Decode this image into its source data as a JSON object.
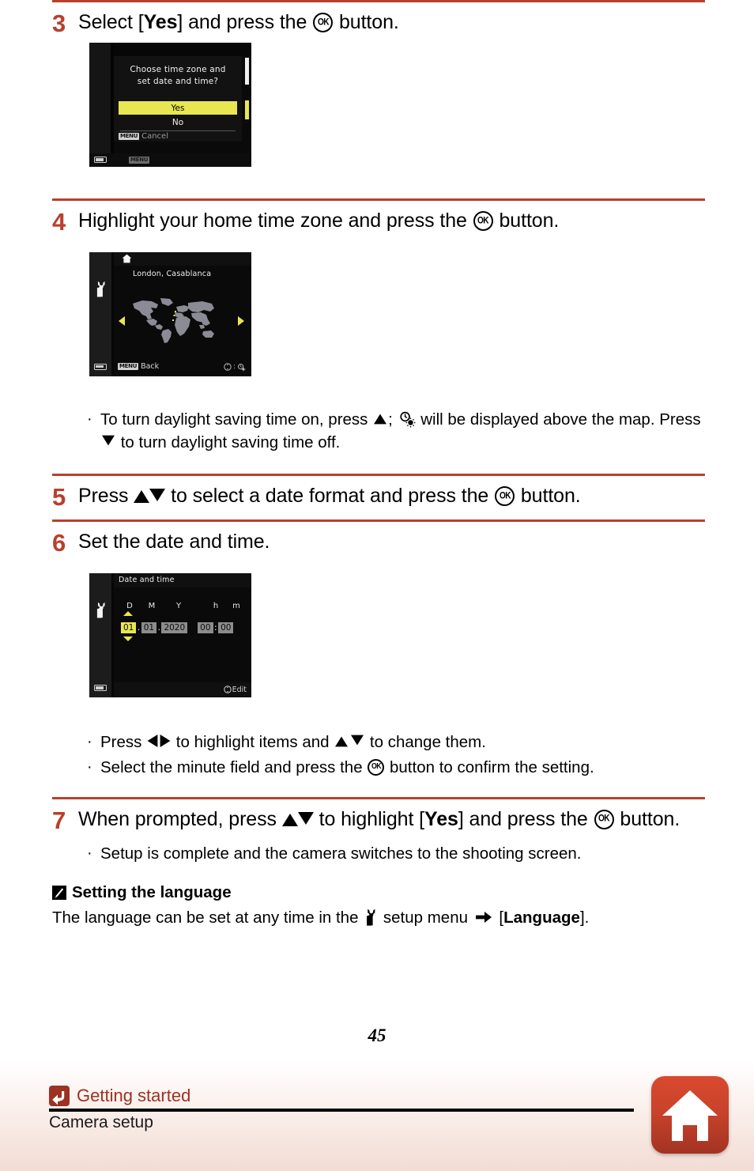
{
  "page": {
    "number": "45",
    "accent_red": "#b8402c",
    "footer_red": "#9d3122"
  },
  "steps": [
    {
      "number": "3",
      "text_before": "Select [",
      "bold": "Yes",
      "text_mid": "] and press the ",
      "text_after": " button."
    },
    {
      "number": "4",
      "text_before": "Highlight your home time zone and press the ",
      "text_after": " button."
    },
    {
      "number": "5",
      "text_before": "Press ",
      "text_mid": " to select a date format and press the ",
      "text_after": " button."
    },
    {
      "number": "6",
      "text_before": "Set the date and time."
    },
    {
      "number": "7",
      "text_before": "When prompted, press ",
      "text_mid": " to highlight [",
      "bold": "Yes",
      "text_mid2": "] and press the ",
      "text_after": " button."
    }
  ],
  "bullets": {
    "after_step4": [
      {
        "p1": "To turn daylight saving time on, press ",
        "p2": "; ",
        "p3": " will be displayed above the map. Press ",
        "p4": " to turn daylight saving time off."
      }
    ],
    "after_step6": [
      {
        "p1": "Press ",
        "p2": " to highlight items and ",
        "p3": " to change them."
      },
      {
        "p1": "Select the minute field and press the ",
        "p2": " button to confirm the setting."
      }
    ],
    "after_step7": [
      {
        "p1": "Setup is complete and the camera switches to the shooting screen."
      }
    ]
  },
  "screen1": {
    "prompt_line1": "Choose time zone and",
    "prompt_line2": "set date and time?",
    "yes": "Yes",
    "no": "No",
    "cancel_chip": "MENU",
    "cancel_label": "Cancel",
    "bottom_chip": "MENU",
    "highlight_color": "#e9e751"
  },
  "screen2": {
    "city": "London, Casablanca",
    "back_chip": "MENU",
    "back_label": "Back",
    "hint": ":",
    "arrow_color": "#e9e751"
  },
  "screen3": {
    "title": "Date and time",
    "columns": [
      "D",
      "M",
      "Y",
      "h",
      "m"
    ],
    "day": "01",
    "month": "01",
    "year": "2020",
    "hour": "00",
    "minute": "00",
    "date_sep": ".",
    "time_sep": ":",
    "edit_label": "Edit",
    "selected_field": "day",
    "highlight_color": "#e9e751"
  },
  "note": {
    "title": "Setting the language",
    "body_p1": "The language can be set at any time in the ",
    "body_p2": " setup menu ",
    "body_p3": " [",
    "body_bold": "Language",
    "body_p4": "]."
  },
  "footer": {
    "breadcrumb": "Getting started",
    "subtitle": "Camera setup",
    "back_icon": "back-arrow-icon",
    "home_icon": "home-icon"
  }
}
